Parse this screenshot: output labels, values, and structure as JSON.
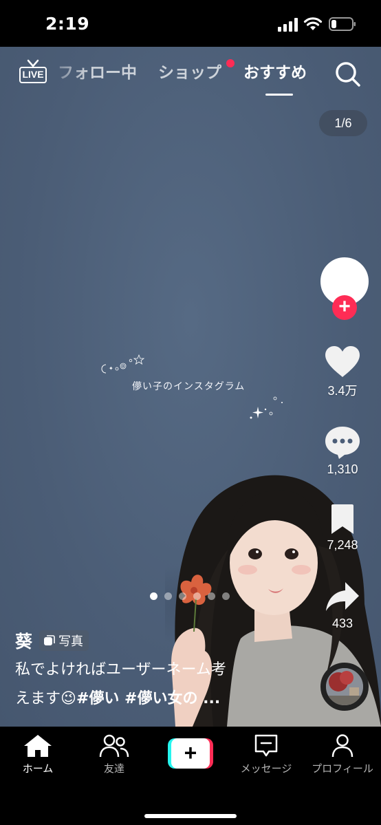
{
  "status_bar": {
    "time": "2:19"
  },
  "top_nav": {
    "live_label": "LIVE",
    "tabs": [
      {
        "label": "フォロー中"
      },
      {
        "label": "ショップ"
      },
      {
        "label": "おすすめ"
      }
    ],
    "active_tab": "おすすめ",
    "search_icon": "search-icon",
    "shop_dot_color": "#fe2c55"
  },
  "post": {
    "page_counter": "1/6",
    "image_caption": "儚い子のインスタグラム",
    "carousel": {
      "total": 6,
      "active_index": 0
    },
    "author": "葵",
    "badge_label": "写真",
    "description_line1": "私でよければユーザーネーム考",
    "description_line2": "えます😉",
    "hashtags": "#儚い #儚い女の ..."
  },
  "actions": {
    "likes": "3.4万",
    "comments": "1,310",
    "bookmarks": "7,248",
    "shares": "433"
  },
  "bottom_nav": {
    "items": [
      {
        "label": "ホーム",
        "icon": "home-icon"
      },
      {
        "label": "友達",
        "icon": "friends-icon"
      },
      {
        "label": "",
        "icon": "plus-icon"
      },
      {
        "label": "メッセージ",
        "icon": "inbox-icon"
      },
      {
        "label": "プロフィール",
        "icon": "profile-icon"
      }
    ],
    "active_index": 0
  },
  "colors": {
    "accent": "#fe2c55",
    "cyan": "#25f4ee",
    "background": "#4c5e78"
  }
}
